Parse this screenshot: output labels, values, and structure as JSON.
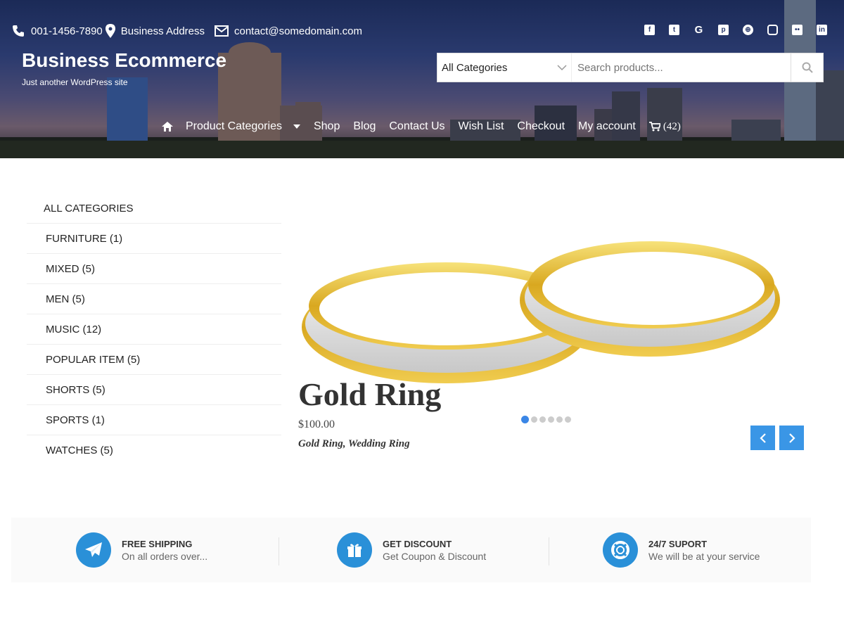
{
  "topbar": {
    "phone": "001-1456-7890",
    "address": "Business Address",
    "email": "contact@somedomain.com"
  },
  "social_icons": [
    "facebook-icon",
    "twitter-icon",
    "google-icon",
    "pinterest-icon",
    "dribbble-icon",
    "instagram-icon",
    "flickr-icon",
    "linkedin-icon"
  ],
  "brand": {
    "title": "Business Ecommerce",
    "tagline": "Just another WordPress site"
  },
  "search": {
    "category": "All Categories",
    "placeholder": "Search products..."
  },
  "nav": {
    "items": [
      "Product Categories",
      "Shop",
      "Blog",
      "Contact Us",
      "Wish List",
      "Checkout",
      "My account"
    ],
    "cart_count": "(42)"
  },
  "sidebar": {
    "heading": "ALL CATEGORIES",
    "items": [
      "FURNITURE (1)",
      "MIXED (5)",
      "MEN (5)",
      "MUSIC (12)",
      "POPULAR ITEM (5)",
      "SHORTS (5)",
      "SPORTS (1)",
      "WATCHES (5)"
    ]
  },
  "slider": {
    "title": "Gold Ring",
    "price": "$100.00",
    "tags": "Gold Ring, Wedding Ring",
    "dot_count": 6,
    "active_dot": 0
  },
  "features": [
    {
      "title": "FREE SHIPPING",
      "subtitle": "On all orders over..."
    },
    {
      "title": "GET DISCOUNT",
      "subtitle": "Get Coupon & Discount"
    },
    {
      "title": "24/7 SUPORT",
      "subtitle": "We will be at your service"
    }
  ],
  "colors": {
    "accent": "#3a96e6",
    "feature_icon_bg": "#2a90d8"
  }
}
